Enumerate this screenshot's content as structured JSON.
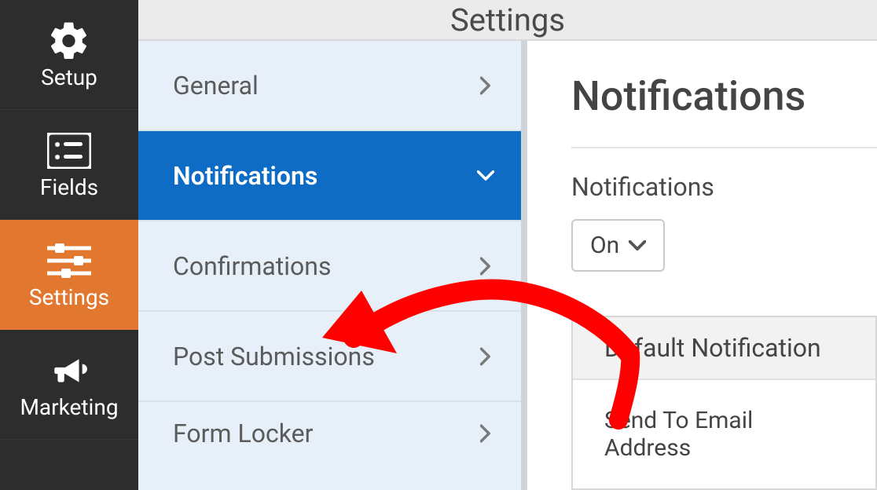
{
  "topbar": {
    "title": "Settings"
  },
  "primary_nav": {
    "items": [
      {
        "label": "Setup"
      },
      {
        "label": "Fields"
      },
      {
        "label": "Settings"
      },
      {
        "label": "Marketing"
      }
    ]
  },
  "sub_sidebar": {
    "items": [
      {
        "label": "General"
      },
      {
        "label": "Notifications"
      },
      {
        "label": "Confirmations"
      },
      {
        "label": "Post Submissions"
      },
      {
        "label": "Form Locker"
      }
    ]
  },
  "detail": {
    "heading": "Notifications",
    "toggle_label": "Notifications",
    "toggle_value": "On",
    "card_title": "Default Notification",
    "field_label": "Send To Email Address"
  }
}
